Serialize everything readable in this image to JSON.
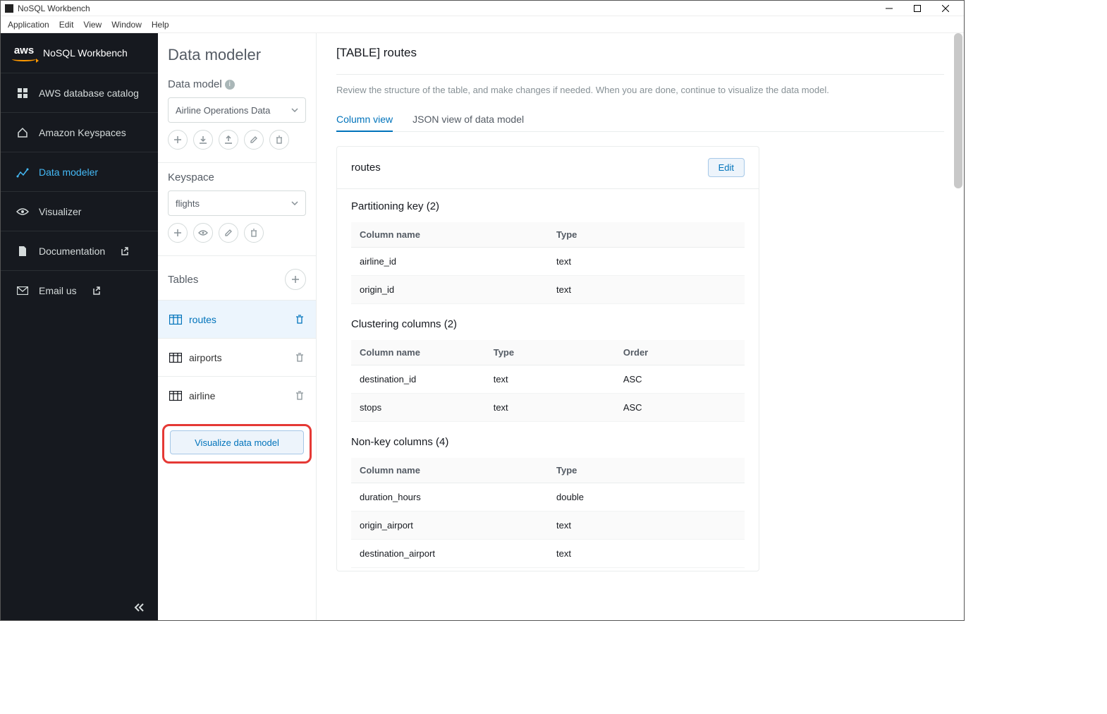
{
  "window": {
    "title": "NoSQL Workbench"
  },
  "menubar": [
    "Application",
    "Edit",
    "View",
    "Window",
    "Help"
  ],
  "brand": {
    "logo_text": "aws",
    "title": "NoSQL Workbench"
  },
  "sidebar": {
    "items": [
      {
        "label": "AWS database catalog"
      },
      {
        "label": "Amazon Keyspaces"
      },
      {
        "label": "Data modeler"
      },
      {
        "label": "Visualizer"
      },
      {
        "label": "Documentation"
      },
      {
        "label": "Email us"
      }
    ]
  },
  "panel2": {
    "heading": "Data modeler",
    "data_model_label": "Data model",
    "data_model_value": "Airline Operations Data",
    "keyspace_label": "Keyspace",
    "keyspace_value": "flights",
    "tables_label": "Tables",
    "tables": [
      {
        "name": "routes"
      },
      {
        "name": "airports"
      },
      {
        "name": "airline"
      }
    ],
    "visualize_label": "Visualize data model"
  },
  "main": {
    "title": "[TABLE] routes",
    "subtitle": "Review the structure of the table, and make changes if needed. When you are done, continue to visualize the data model.",
    "tabs": [
      {
        "label": "Column view"
      },
      {
        "label": "JSON view of data model"
      }
    ],
    "card_name": "routes",
    "edit_label": "Edit",
    "headers": {
      "column_name": "Column name",
      "type": "Type",
      "order": "Order"
    },
    "partition": {
      "title": "Partitioning key (2)",
      "rows": [
        {
          "name": "airline_id",
          "type": "text"
        },
        {
          "name": "origin_id",
          "type": "text"
        }
      ]
    },
    "clustering": {
      "title": "Clustering columns (2)",
      "rows": [
        {
          "name": "destination_id",
          "type": "text",
          "order": "ASC"
        },
        {
          "name": "stops",
          "type": "text",
          "order": "ASC"
        }
      ]
    },
    "nonkey": {
      "title": "Non-key columns (4)",
      "rows": [
        {
          "name": "duration_hours",
          "type": "double"
        },
        {
          "name": "origin_airport",
          "type": "text"
        },
        {
          "name": "destination_airport",
          "type": "text"
        }
      ]
    }
  }
}
